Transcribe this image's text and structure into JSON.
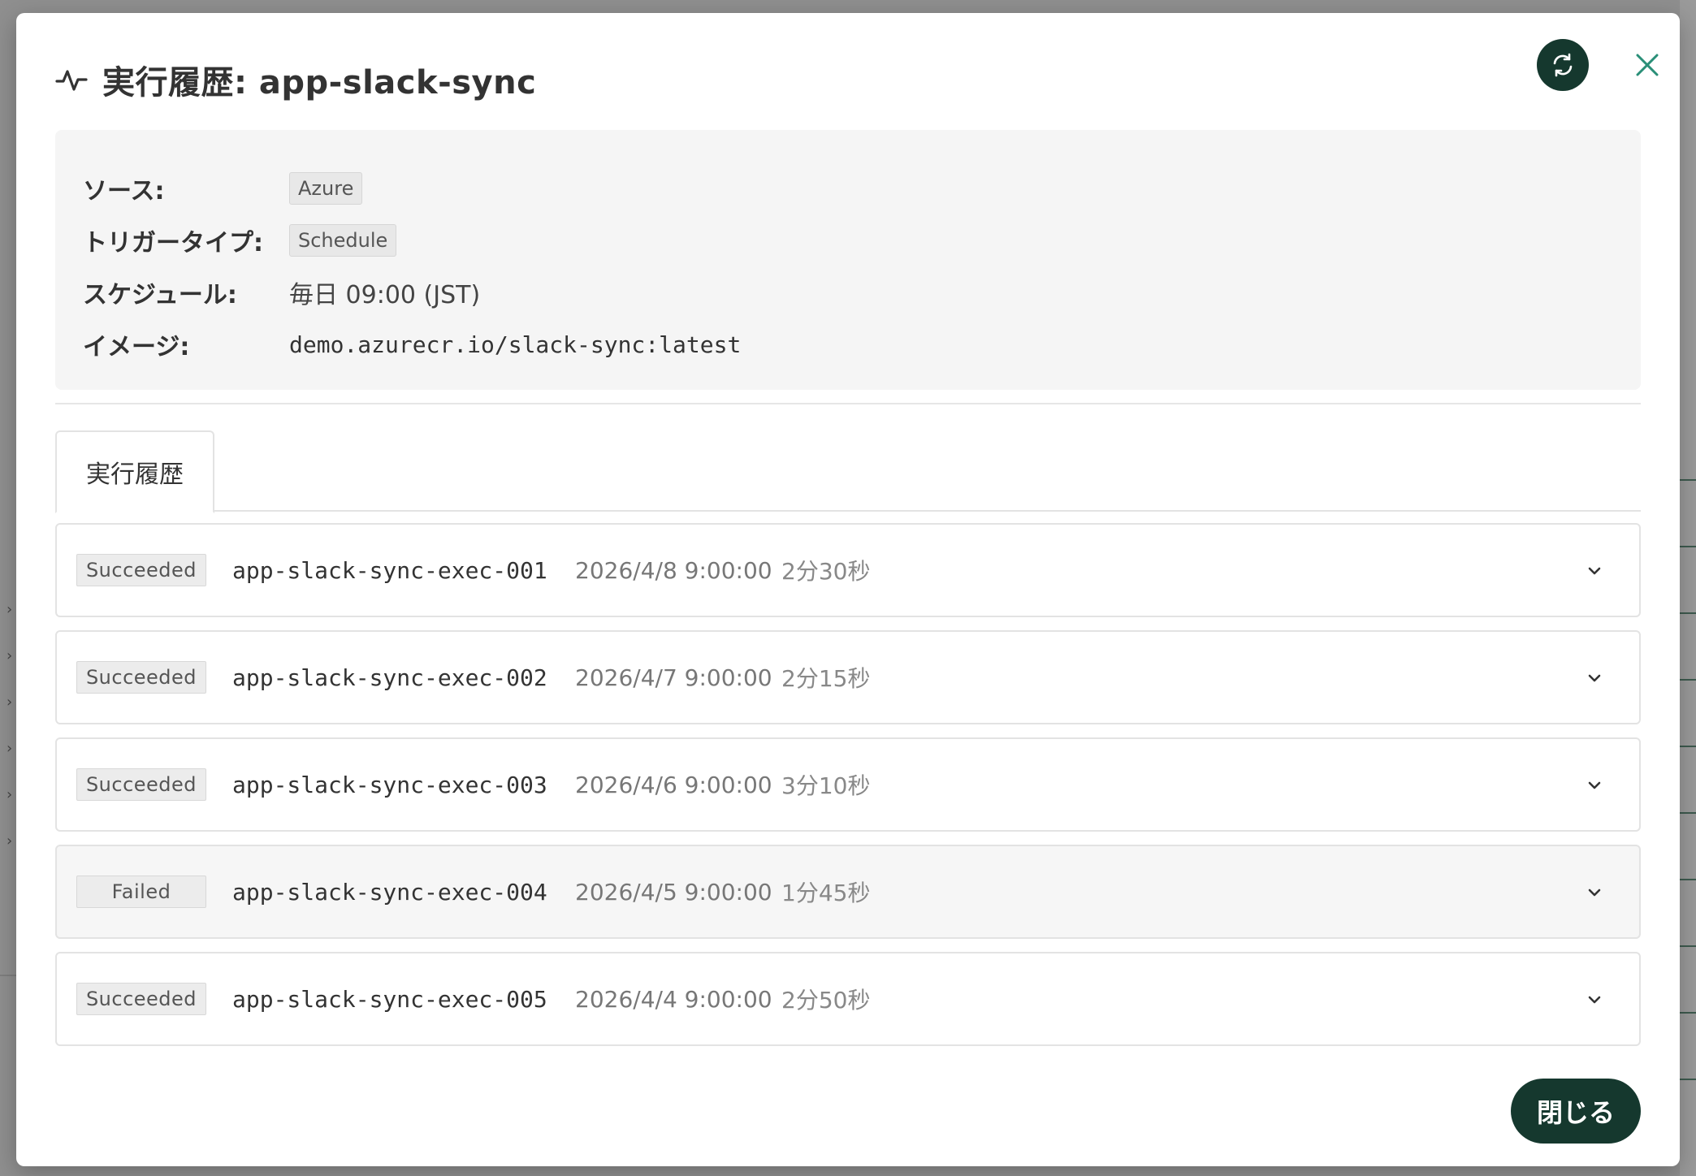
{
  "modal": {
    "title": "実行履歴: app-slack-sync",
    "icons": {
      "header": "activity-icon",
      "refresh": "refresh-icon",
      "close": "close-icon"
    }
  },
  "info": {
    "source": {
      "label": "ソース:",
      "value": "Azure"
    },
    "trigger": {
      "label": "トリガータイプ:",
      "value": "Schedule"
    },
    "schedule": {
      "label": "スケジュール:",
      "value": "毎日 09:00 (JST)"
    },
    "image": {
      "label": "イメージ:",
      "value": "demo.azurecr.io/slack-sync:latest"
    }
  },
  "tabs": [
    {
      "label": "実行履歴",
      "active": true
    }
  ],
  "executions": [
    {
      "status": "Succeeded",
      "id": "app-slack-sync-exec-001",
      "started": "2026/4/8 9:00:00",
      "duration": "2分30秒"
    },
    {
      "status": "Succeeded",
      "id": "app-slack-sync-exec-002",
      "started": "2026/4/7 9:00:00",
      "duration": "2分15秒"
    },
    {
      "status": "Succeeded",
      "id": "app-slack-sync-exec-003",
      "started": "2026/4/6 9:00:00",
      "duration": "3分10秒"
    },
    {
      "status": "Failed",
      "id": "app-slack-sync-exec-004",
      "started": "2026/4/5 9:00:00",
      "duration": "1分45秒"
    },
    {
      "status": "Succeeded",
      "id": "app-slack-sync-exec-005",
      "started": "2026/4/4 9:00:00",
      "duration": "2分50秒"
    }
  ],
  "footer": {
    "close_label": "閉じる"
  },
  "colors": {
    "primary": "#15382e",
    "accent": "#2a8f78",
    "panel_bg": "#f5f5f5"
  }
}
